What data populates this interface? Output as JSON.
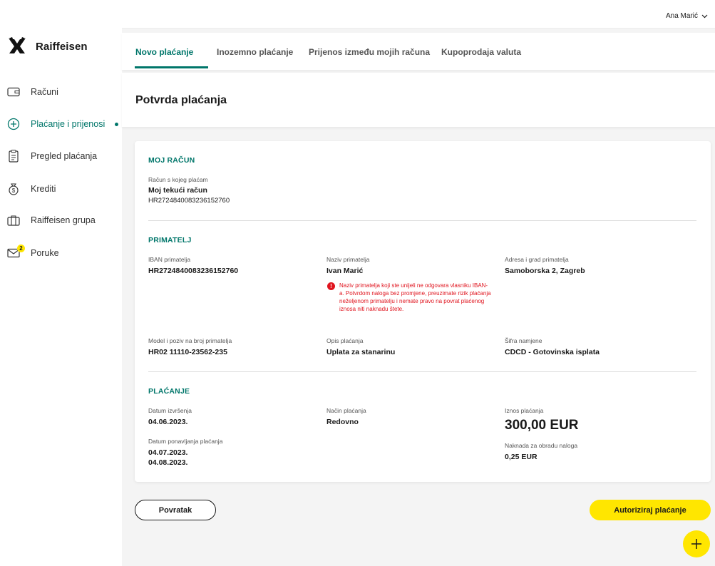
{
  "colors": {
    "accent": "#00766a",
    "brand_yellow": "#ffe600",
    "warning": "#e0141e"
  },
  "brand": {
    "name": "Raiffeisen",
    "logo_icon": "raiffeisen-cross-logo"
  },
  "sidebar": {
    "items": [
      {
        "label": "Računi",
        "icon": "wallet-icon"
      },
      {
        "label": "Plaćanje i prijenosi",
        "icon": "plus-circle-icon",
        "active": true
      },
      {
        "label": "Pregled plaćanja",
        "icon": "clipboard-icon"
      },
      {
        "label": "Krediti",
        "icon": "money-bag-icon"
      },
      {
        "label": "Raiffeisen grupa",
        "icon": "briefcase-icon"
      },
      {
        "label": "Poruke",
        "icon": "envelope-icon",
        "badge": "2"
      }
    ]
  },
  "header": {
    "user_name": "Ana Marić"
  },
  "tabs": [
    {
      "label": "Novo plaćanje",
      "active": true
    },
    {
      "label": "Inozemno plaćanje"
    },
    {
      "label": "Prijenos između mojih računa"
    },
    {
      "label": "Kupoprodaja valuta"
    }
  ],
  "page_title": "Potvrda plaćanja",
  "moj_racun": {
    "heading": "MOJ RAČUN",
    "label": "Račun s kojeg plaćam",
    "account_name": "Moj tekući račun",
    "iban": "HR2724840083236152760"
  },
  "primatelj": {
    "heading": "PRIMATELJ",
    "iban_label": "IBAN primatelja",
    "iban_value": "HR2724840083236152760",
    "name_label": "Naziv primatelja",
    "name_value": "Ivan Marić",
    "warning": "Naziv primatelja koji ste unijeli ne odgovara vlasniku IBAN-a. Potvrdom naloga bez promjene, preuzimate rizik plaćanja neželjenom primatelju i nemate pravo na povrat plaćenog iznosa niti naknadu štete.",
    "address_label": "Adresa i grad primatelja",
    "address_value": "Samoborska 2, Zagreb",
    "model_label": "Model i poziv na broj primatelja",
    "model_value": "HR02 11110-23562-235",
    "desc_label": "Opis plaćanja",
    "desc_value": "Uplata za stanarinu",
    "code_label": "Šifra namjene",
    "code_value": "CDCD - Gotovinska isplata"
  },
  "placanje": {
    "heading": "PLAĆANJE",
    "date_label": "Datum izvršenja",
    "date_value": "04.06.2023.",
    "repeat_label": "Datum ponavljanja plaćanja",
    "repeat_dates": [
      "04.07.2023.",
      "04.08.2023."
    ],
    "method_label": "Način plaćanja",
    "method_value": "Redovno",
    "amount_label": "Iznos plaćanja",
    "amount_value": "300,00 EUR",
    "fee_label": "Naknada za obradu naloga",
    "fee_value": "0,25 EUR"
  },
  "actions": {
    "back_label": "Povratak",
    "authorize_label": "Autoriziraj plaćanje",
    "fab_icon": "plus-icon"
  }
}
